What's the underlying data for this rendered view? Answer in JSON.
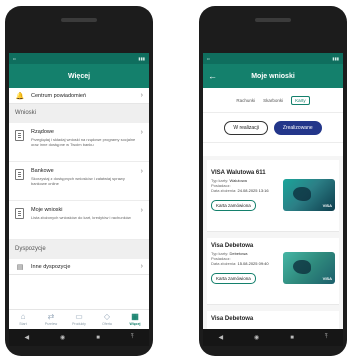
{
  "left": {
    "title": "Więcej",
    "notification_row": "Centrum powiadomień",
    "section_wnioski": "Wnioski",
    "items": [
      {
        "title": "Rządowe",
        "desc": "Przeglądaj i składaj wnioski na rządowe programy socjalne oraz inne dostępne w Twoim banku"
      },
      {
        "title": "Bankowe",
        "desc": "Skorzystaj z dostępnych wniosków i załatwiaj sprawy bankowe online"
      },
      {
        "title": "Moje wnioski",
        "desc": "Lista złożonych wniosków do kart, kredytów i rachunków"
      }
    ],
    "section_dyspozycje": "Dyspozycje",
    "inne_dyspozycje": "Inne dyspozycje",
    "nav": [
      "Start",
      "Przelew",
      "Produkty",
      "Oferta",
      "Więcej"
    ]
  },
  "right": {
    "title": "Moje wnioski",
    "tabs": [
      "Rachunki",
      "Skarbonki",
      "Karty"
    ],
    "seg": [
      "W realizacji",
      "Zrealizowane"
    ],
    "cards": [
      {
        "name": "VISA Walutowa 611",
        "type_label": "Typ karty:",
        "type_value": "Walutowa",
        "owner_label": "Posiadacz:",
        "date_label": "Data złożenia:",
        "date_value": "24.08.2025 13:16",
        "button": "Karta zamówiona",
        "brand": "VISA"
      },
      {
        "name": "Visa Debetowa",
        "type_label": "Typ karty:",
        "type_value": "Debetowa",
        "owner_label": "Posiadacz:",
        "date_label": "Data złożenia:",
        "date_value": "15.08.2025 09:40",
        "button": "Karta zamówiona",
        "brand": "VISA"
      }
    ],
    "peek_title": "Visa Debetowa"
  },
  "colors": {
    "primary": "#14806c",
    "status": "#0f6e5e",
    "accent": "#23368a"
  }
}
